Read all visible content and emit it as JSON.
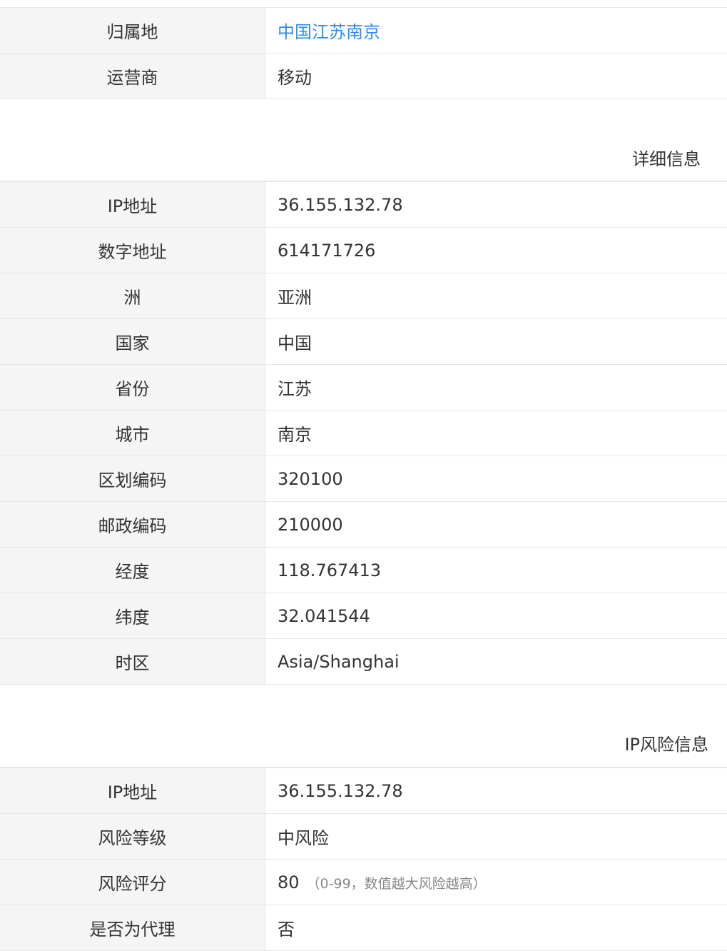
{
  "top": {
    "rows": [
      {
        "label": "归属地",
        "value": "中国江苏南京"
      },
      {
        "label": "运营商",
        "value": "移动"
      }
    ]
  },
  "detail": {
    "title": "详细信息",
    "rows": [
      {
        "label": "IP地址",
        "value": "36.155.132.78"
      },
      {
        "label": "数字地址",
        "value": "614171726"
      },
      {
        "label": "洲",
        "value": "亚洲"
      },
      {
        "label": "国家",
        "value": "中国"
      },
      {
        "label": "省份",
        "value": "江苏"
      },
      {
        "label": "城市",
        "value": "南京"
      },
      {
        "label": "区划编码",
        "value": "320100"
      },
      {
        "label": "邮政编码",
        "value": "210000"
      },
      {
        "label": "经度",
        "value": "118.767413"
      },
      {
        "label": "纬度",
        "value": "32.041544"
      },
      {
        "label": "时区",
        "value": "Asia/Shanghai"
      }
    ]
  },
  "risk": {
    "title": "IP风险信息",
    "rows": [
      {
        "label": "IP地址",
        "value": "36.155.132.78"
      },
      {
        "label": "风险等级",
        "value": "中风险"
      },
      {
        "label": "风险评分",
        "value": "80",
        "note": "（0-99，数值越大风险越高）"
      },
      {
        "label": "是否为代理",
        "value": "否"
      }
    ]
  },
  "colors": {
    "link": "#2d8cf0",
    "label_bg": "#f5f5f5",
    "border": "#e6e6e6"
  }
}
